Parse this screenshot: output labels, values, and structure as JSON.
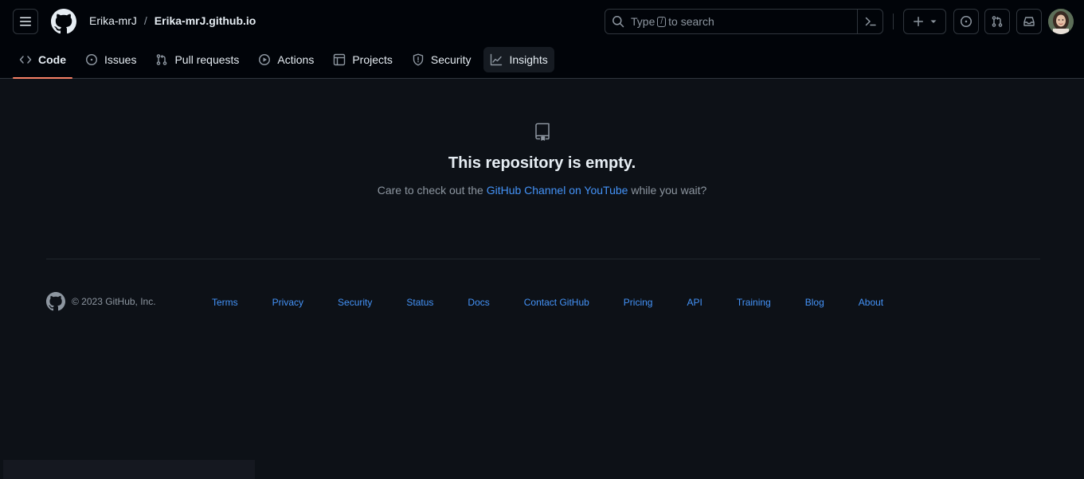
{
  "header": {
    "owner": "Erika-mrJ",
    "separator": "/",
    "repo": "Erika-mrJ.github.io",
    "search": {
      "prefix": "Type",
      "key": "/",
      "suffix": "to search"
    }
  },
  "repo_nav": {
    "tabs": [
      {
        "label": "Code",
        "icon": "code-icon",
        "selected": true
      },
      {
        "label": "Issues",
        "icon": "issue-opened-icon"
      },
      {
        "label": "Pull requests",
        "icon": "git-pull-request-icon"
      },
      {
        "label": "Actions",
        "icon": "play-icon"
      },
      {
        "label": "Projects",
        "icon": "table-icon"
      },
      {
        "label": "Security",
        "icon": "shield-icon"
      },
      {
        "label": "Insights",
        "icon": "graph-icon"
      }
    ]
  },
  "blankslate": {
    "title": "This repository is empty.",
    "text_before": "Care to check out the",
    "link": "GitHub Channel on YouTube",
    "text_after": "while you wait?"
  },
  "footer": {
    "copyright": "© 2023 GitHub, Inc.",
    "links": [
      "Terms",
      "Privacy",
      "Security",
      "Status",
      "Docs",
      "Contact GitHub",
      "Pricing",
      "API",
      "Training",
      "Blog",
      "About"
    ]
  },
  "colors": {
    "header_bg": "#010409",
    "page_bg": "#0d1117",
    "link": "#4493f8",
    "accent_underline": "#f78166",
    "muted_text": "#8d96a0"
  }
}
